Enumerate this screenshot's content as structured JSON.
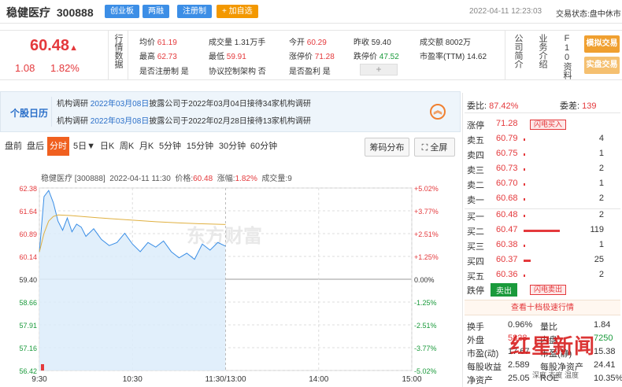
{
  "header": {
    "stock_name": "稳健医疗",
    "stock_code": "300888",
    "tags": [
      "创业板",
      "两融",
      "注册制"
    ],
    "add_watch": "+ 加自选",
    "datetime": "2022-04-11 12:23:03",
    "trade_status": "交易状态:盘中休市"
  },
  "quote": {
    "price": "60.48",
    "change": "1.08",
    "change_pct": "1.82%",
    "section_label": "行情数据",
    "cells": [
      {
        "label": "均价",
        "value": "61.19",
        "color": "#e4393c"
      },
      {
        "label": "成交量",
        "value": "1.31万手",
        "color": "#333333"
      },
      {
        "label": "今开",
        "value": "60.29",
        "color": "#e4393c"
      },
      {
        "label": "昨收",
        "value": "59.40",
        "color": "#333333"
      },
      {
        "label": "成交额",
        "value": "8002万",
        "color": "#333333"
      },
      {
        "label": "最高",
        "value": "62.73",
        "color": "#e4393c"
      },
      {
        "label": "最低",
        "value": "59.91",
        "color": "#e4393c"
      },
      {
        "label": "涨停价",
        "value": "71.28",
        "color": "#e4393c"
      },
      {
        "label": "跌停价",
        "value": "47.52",
        "color": "#1a9a3b"
      },
      {
        "label": "市盈率(TTM)",
        "value": "14.62",
        "color": "#333333"
      },
      {
        "label": "是否注册制",
        "value": "是",
        "color": "#333333"
      },
      {
        "label": "协议控制架构",
        "value": "否",
        "color": "#333333"
      },
      {
        "label": "是否盈利",
        "value": "是",
        "color": "#333333"
      }
    ],
    "side_links": [
      "公司简介",
      "业务介绍",
      "F10资料"
    ],
    "trade_buttons": [
      "模拟交易",
      "实盘交易"
    ]
  },
  "calendar": {
    "title": "个股日历",
    "items": [
      {
        "type": "机构调研",
        "date": "2022年03月08日",
        "text": "披露公司于2022年03月04日接待34家机构调研"
      },
      {
        "type": "机构调研",
        "date": "2022年03月08日",
        "text": "披露公司于2022年02月28日接待13家机构调研"
      }
    ]
  },
  "chart_tabs": [
    "盘前",
    "盘后",
    "分时",
    "5日▼",
    "日K",
    "周K",
    "月K",
    "5分钟",
    "15分钟",
    "30分钟",
    "60分钟"
  ],
  "chart_buttons": {
    "chip": "筹码分布",
    "fullscreen": "全屏"
  },
  "chart_header": {
    "name": "稳健医疗 [300888]",
    "time": "2022-04-11 11:30",
    "price_label": "价格:",
    "price": "60.48",
    "pct_label": "涨幅:",
    "pct": "1.82%",
    "vol_label": "成交量:",
    "vol": "9"
  },
  "watermark_text": "东方财富",
  "chart_data": {
    "type": "line",
    "title": "",
    "prev_close": 59.4,
    "ylim": [
      56.42,
      62.38
    ],
    "y_ticks_left": [
      "62.38",
      "61.64",
      "60.89",
      "60.14",
      "59.40",
      "58.66",
      "57.91",
      "57.16",
      "56.42"
    ],
    "y_ticks_right": [
      "+5.02%",
      "+3.77%",
      "+2.51%",
      "+1.25%",
      "0.00%",
      "-1.25%",
      "-2.51%",
      "-3.77%",
      "-5.02%"
    ],
    "x_ticks": [
      "9:30",
      "10:30",
      "11:30/13:00",
      "14:00",
      "15:00"
    ],
    "series": [
      {
        "name": "价格",
        "color": "#3a8ee6",
        "x": [
          0,
          3,
          6,
          9,
          12,
          15,
          18,
          21,
          24,
          27,
          30,
          35,
          40,
          45,
          50,
          55,
          60,
          65,
          70,
          75,
          80,
          85,
          90,
          95,
          100,
          105,
          110,
          115,
          120
        ],
        "values": [
          60.29,
          62.1,
          62.3,
          61.9,
          61.3,
          61.0,
          61.4,
          60.95,
          61.2,
          61.1,
          60.8,
          61.05,
          60.7,
          60.5,
          60.6,
          60.9,
          60.55,
          60.3,
          60.6,
          60.45,
          60.65,
          60.3,
          60.1,
          60.25,
          60.05,
          60.55,
          60.35,
          60.6,
          60.48
        ]
      },
      {
        "name": "均价",
        "color": "#e0b040",
        "x": [
          0,
          3,
          6,
          9,
          12,
          20,
          30,
          45,
          60,
          75,
          90,
          105,
          120
        ],
        "values": [
          60.29,
          60.9,
          61.3,
          61.45,
          61.5,
          61.48,
          61.44,
          61.38,
          61.33,
          61.28,
          61.24,
          61.21,
          61.19
        ]
      }
    ]
  },
  "orderbook": {
    "wei_bi_label": "委比:",
    "wei_bi": "87.42%",
    "wei_cha_label": "委差:",
    "wei_cha": "139",
    "limit_up": {
      "label": "涨停",
      "price": "71.28",
      "badge": "闪电买入"
    },
    "asks": [
      {
        "label": "卖五",
        "price": "60.79",
        "vol": "4",
        "bar": 0.03
      },
      {
        "label": "卖四",
        "price": "60.75",
        "vol": "1",
        "bar": 0.01
      },
      {
        "label": "卖三",
        "price": "60.73",
        "vol": "2",
        "bar": 0.02
      },
      {
        "label": "卖二",
        "price": "60.70",
        "vol": "1",
        "bar": 0.01
      },
      {
        "label": "卖一",
        "price": "60.68",
        "vol": "2",
        "bar": 0.02
      }
    ],
    "bids": [
      {
        "label": "买一",
        "price": "60.48",
        "vol": "2",
        "bar": 0.02
      },
      {
        "label": "买二",
        "price": "60.47",
        "vol": "119",
        "bar": 1.0
      },
      {
        "label": "买三",
        "price": "60.38",
        "vol": "1",
        "bar": 0.01
      },
      {
        "label": "买四",
        "price": "60.37",
        "vol": "25",
        "bar": 0.2
      },
      {
        "label": "买五",
        "price": "60.36",
        "vol": "2",
        "bar": 0.02
      }
    ],
    "limit_down": {
      "label": "跌停",
      "sell": "卖出",
      "badge": "闪电卖出"
    },
    "level10_link": "查看十档极速行情"
  },
  "stats": [
    {
      "l1": "换手",
      "v1": "0.96%",
      "c1": "#333333",
      "l2": "量比",
      "v2": "1.84",
      "c2": "#333333"
    },
    {
      "l1": "外盘",
      "v1": "5828",
      "c1": "#e4393c",
      "l2": "内盘",
      "v2": "7250",
      "c2": "#1a9a3b"
    },
    {
      "l1": "市盈(动)",
      "v1": "17.67",
      "c1": "#333333",
      "l2": "市盈(静)",
      "v2": "15.38",
      "c2": "#333333"
    },
    {
      "l1": "每股收益",
      "v1": "2.589",
      "c1": "#333333",
      "l2": "每股净资产",
      "v2": "24.41",
      "c2": "#333333"
    },
    {
      "l1": "净资产",
      "v1": "25.05",
      "c1": "#333333",
      "l2": "ROE",
      "v2": "10.35%",
      "c2": "#333333"
    }
  ],
  "news_watermark": {
    "text": "红星新闻",
    "sub": "深度 态度 温度"
  }
}
